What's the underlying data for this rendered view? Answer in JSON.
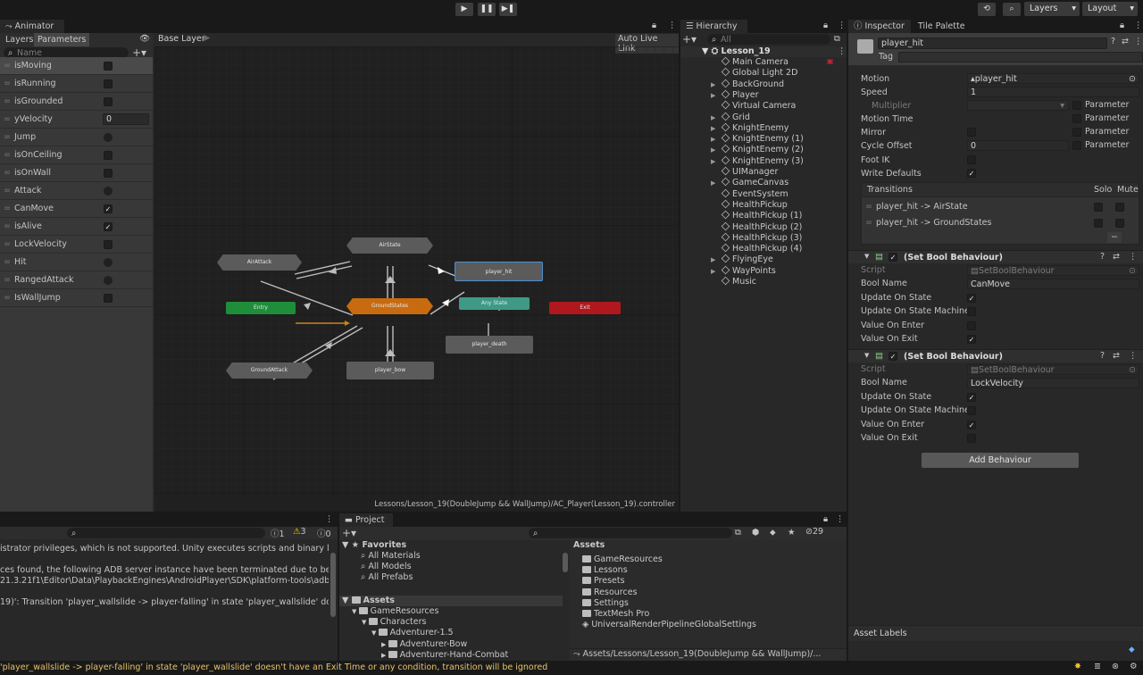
{
  "toolbar": {
    "layers": "Layers",
    "layout": "Layout"
  },
  "animator": {
    "tab": "Animator",
    "layers_tab": "Layers",
    "params_tab": "Parameters",
    "search_placeholder": "Name",
    "breadcrumb": "Base Layer",
    "auto_live": "Auto Live Link",
    "path": "Lessons/Lesson_19(DoubleJump && WallJump)/AC_Player(Lesson_19).controller",
    "params": [
      {
        "name": "isMoving",
        "kind": "bool",
        "checked": false
      },
      {
        "name": "isRunning",
        "kind": "bool",
        "checked": false
      },
      {
        "name": "isGrounded",
        "kind": "bool",
        "checked": false
      },
      {
        "name": "yVelocity",
        "kind": "float",
        "value": "0"
      },
      {
        "name": "Jump",
        "kind": "trigger"
      },
      {
        "name": "isOnCeiling",
        "kind": "bool",
        "checked": false
      },
      {
        "name": "isOnWall",
        "kind": "bool",
        "checked": false
      },
      {
        "name": "Attack",
        "kind": "trigger"
      },
      {
        "name": "CanMove",
        "kind": "bool",
        "checked": true
      },
      {
        "name": "isAlive",
        "kind": "bool",
        "checked": true
      },
      {
        "name": "LockVelocity",
        "kind": "bool",
        "checked": false
      },
      {
        "name": "Hit",
        "kind": "trigger"
      },
      {
        "name": "RangedAttack",
        "kind": "trigger"
      },
      {
        "name": "IsWallJump",
        "kind": "bool",
        "checked": false
      }
    ],
    "nodes": {
      "airstate": "AirState",
      "airattack": "AirAttack",
      "player_hit": "player_hit",
      "entry": "Entry",
      "groundstates": "GroundStates",
      "anystate": "Any State",
      "exit": "Exit",
      "player_death": "player_death",
      "groundattack": "GroundAttack",
      "player_bow": "player_bow"
    }
  },
  "hierarchy": {
    "tab": "Hierarchy",
    "search_placeholder": "All",
    "scene": "Lesson_19",
    "items": [
      {
        "label": "Main Camera",
        "expand": false
      },
      {
        "label": "Global Light 2D",
        "expand": false
      },
      {
        "label": "BackGround",
        "expand": true
      },
      {
        "label": "Player",
        "expand": true
      },
      {
        "label": "Virtual Camera",
        "expand": false
      },
      {
        "label": "Grid",
        "expand": true
      },
      {
        "label": "KnightEnemy",
        "expand": true
      },
      {
        "label": "KnightEnemy (1)",
        "expand": true
      },
      {
        "label": "KnightEnemy (2)",
        "expand": true
      },
      {
        "label": "KnightEnemy (3)",
        "expand": true
      },
      {
        "label": "UIManager",
        "expand": false
      },
      {
        "label": "GameCanvas",
        "expand": true
      },
      {
        "label": "EventSystem",
        "expand": false
      },
      {
        "label": "HealthPickup",
        "expand": false
      },
      {
        "label": "HealthPickup (1)",
        "expand": false
      },
      {
        "label": "HealthPickup (2)",
        "expand": false
      },
      {
        "label": "HealthPickup (3)",
        "expand": false
      },
      {
        "label": "HealthPickup (4)",
        "expand": false
      },
      {
        "label": "FlyingEye",
        "expand": true
      },
      {
        "label": "WayPoints",
        "expand": true
      },
      {
        "label": "Music",
        "expand": false
      }
    ]
  },
  "inspector": {
    "tab": "Inspector",
    "tab2": "Tile Palette",
    "name": "player_hit",
    "tag": "Tag",
    "motion_label": "Motion",
    "motion_value": "player_hit",
    "speed_label": "Speed",
    "speed_value": "1",
    "multiplier": "Multiplier",
    "parameter": "Parameter",
    "motion_time": "Motion Time",
    "mirror": "Mirror",
    "cycle_offset": "Cycle Offset",
    "cycle_offset_value": "0",
    "foot_ik": "Foot IK",
    "write_defaults": "Write Defaults",
    "transitions": "Transitions",
    "solo": "Solo",
    "mute": "Mute",
    "transition_items": [
      "player_hit -> AirState",
      "player_hit -> GroundStates"
    ],
    "behaviours": [
      {
        "title": "(Set Bool Behaviour)",
        "script_label": "Script",
        "script": "SetBoolBehaviour",
        "bool_name_label": "Bool Name",
        "bool_name": "CanMove",
        "flags": [
          {
            "label": "Update On State",
            "checked": true
          },
          {
            "label": "Update On State Machine",
            "checked": false
          },
          {
            "label": "Value On Enter",
            "checked": false
          },
          {
            "label": "Value On Exit",
            "checked": true
          }
        ]
      },
      {
        "title": "(Set Bool Behaviour)",
        "script_label": "Script",
        "script": "SetBoolBehaviour",
        "bool_name_label": "Bool Name",
        "bool_name": "LockVelocity",
        "flags": [
          {
            "label": "Update On State",
            "checked": true
          },
          {
            "label": "Update On State Machine",
            "checked": false
          },
          {
            "label": "Value On Enter",
            "checked": true
          },
          {
            "label": "Value On Exit",
            "checked": false
          }
        ]
      }
    ],
    "add_behaviour": "Add Behaviour",
    "asset_labels": "Asset Labels"
  },
  "console": {
    "count_info": "1",
    "count_warn": "3",
    "count_error": "0",
    "lines": [
      "istrator privileges, which is not supported. Unity executes scripts and binary libraries in",
      "",
      "ces found, the following ADB server instance have been terminated due to being run fr",
      "21.3.21f1\\Editor\\Data\\PlaybackEngines\\AndroidPlayer\\SDK\\platform-tools\\adb.exe",
      "",
      "19)': Transition 'player_wallslide -> player-falling' in state 'player_wallslide' doesn't hav"
    ]
  },
  "project": {
    "tab": "Project",
    "hidden_count": "29",
    "favorites": "Favorites",
    "fav_items": [
      "All Materials",
      "All Models",
      "All Prefabs"
    ],
    "assets": "Assets",
    "tree": [
      {
        "label": "GameResources",
        "indent": 1
      },
      {
        "label": "Characters",
        "indent": 2
      },
      {
        "label": "Adventurer-1.5",
        "indent": 3
      },
      {
        "label": "Adventurer-Bow",
        "indent": 4
      },
      {
        "label": "Adventurer-Hand-Combat",
        "indent": 4
      }
    ],
    "assets_header": "Assets",
    "asset_items": [
      "GameResources",
      "Lessons",
      "Presets",
      "Resources",
      "Settings",
      "TextMesh Pro",
      "UniversalRenderPipelineGlobalSettings"
    ],
    "path": "Assets/Lessons/Lesson_19(DoubleJump && WallJump)/..."
  },
  "status": {
    "message": "'player_wallslide -> player-falling' in state 'player_wallslide' doesn't have an Exit Time or any condition, transition will be ignored"
  }
}
